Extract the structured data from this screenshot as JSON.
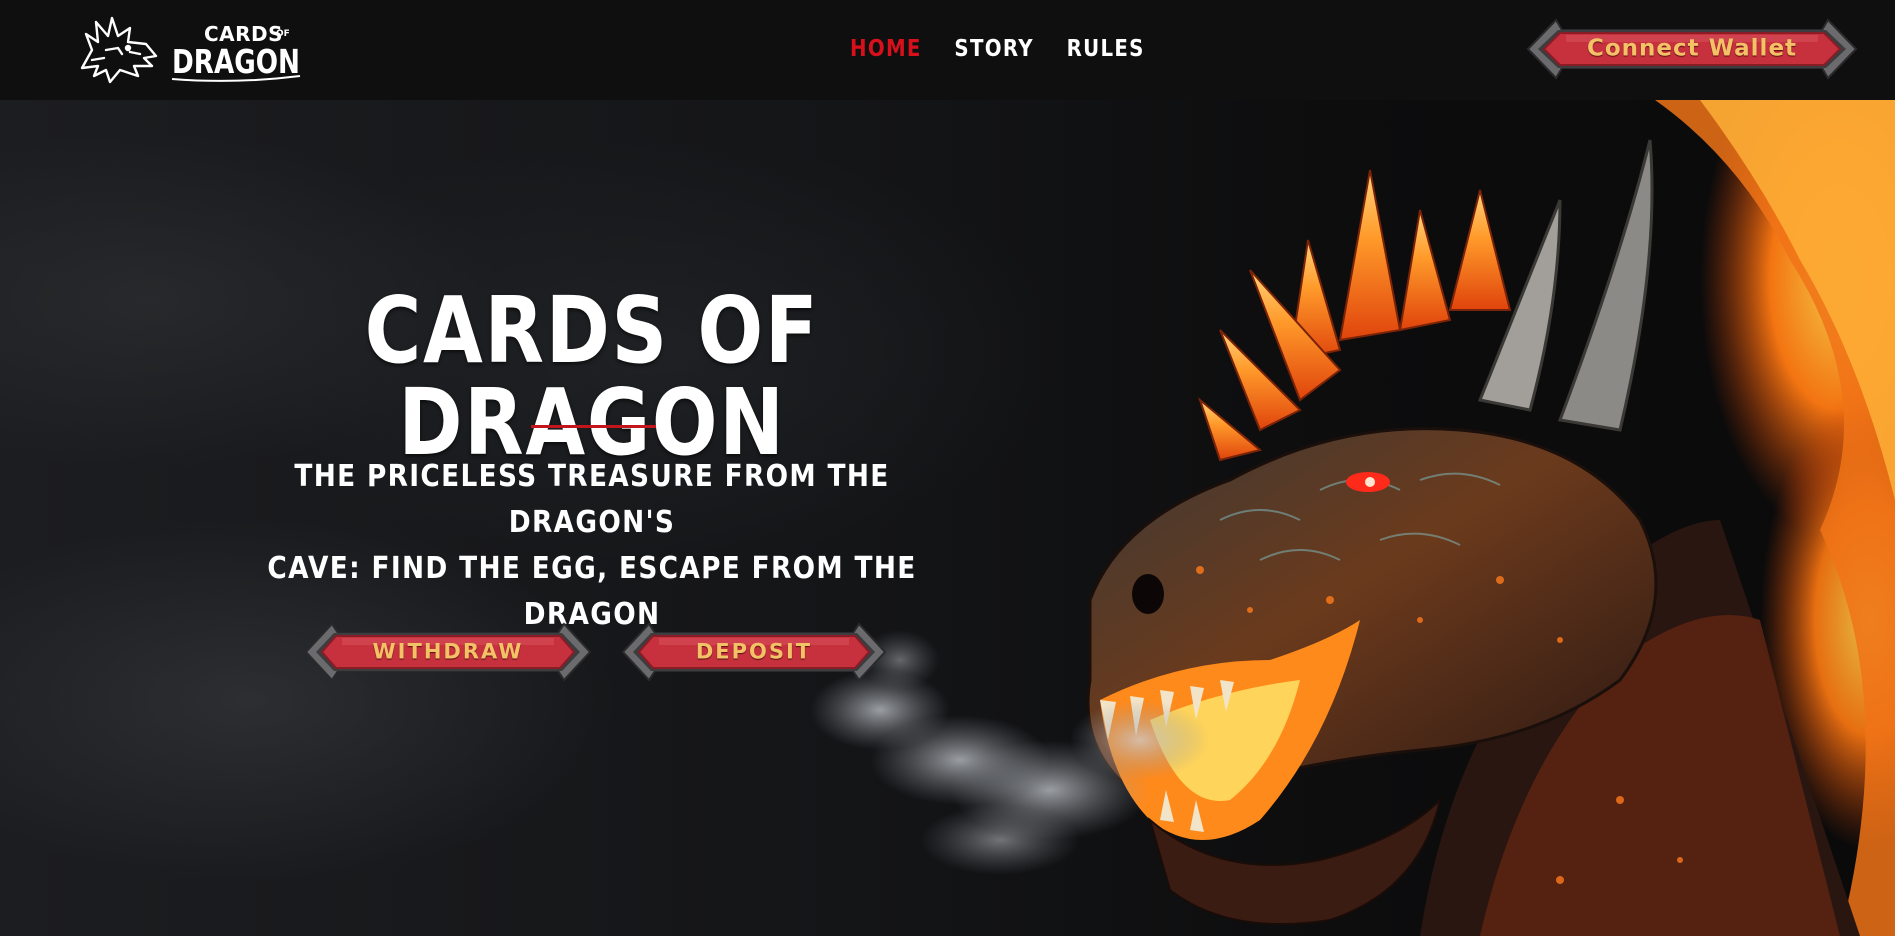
{
  "header": {
    "logo": {
      "top_text": "CARDS",
      "small_text": "OF",
      "main_text": "DRAGON"
    },
    "nav": [
      {
        "label": "HOME",
        "active": true
      },
      {
        "label": "STORY",
        "active": false
      },
      {
        "label": "RULES",
        "active": false
      }
    ],
    "connect_wallet_label": "Connect Wallet"
  },
  "hero": {
    "title": "CARDS OF DRAGON",
    "subtitle_line1": "THE PRICELESS TREASURE FROM THE DRAGON'S",
    "subtitle_line2": "CAVE: FIND THE EGG, ESCAPE FROM THE DRAGON",
    "withdraw_label": "WITHDRAW",
    "deposit_label": "DEPOSIT"
  },
  "colors": {
    "accent_red": "#d8101c",
    "button_red": "#c6313d",
    "button_text": "#f3c267",
    "header_bg": "#0f0f10"
  },
  "icons": [
    "dragon-logo-icon"
  ]
}
